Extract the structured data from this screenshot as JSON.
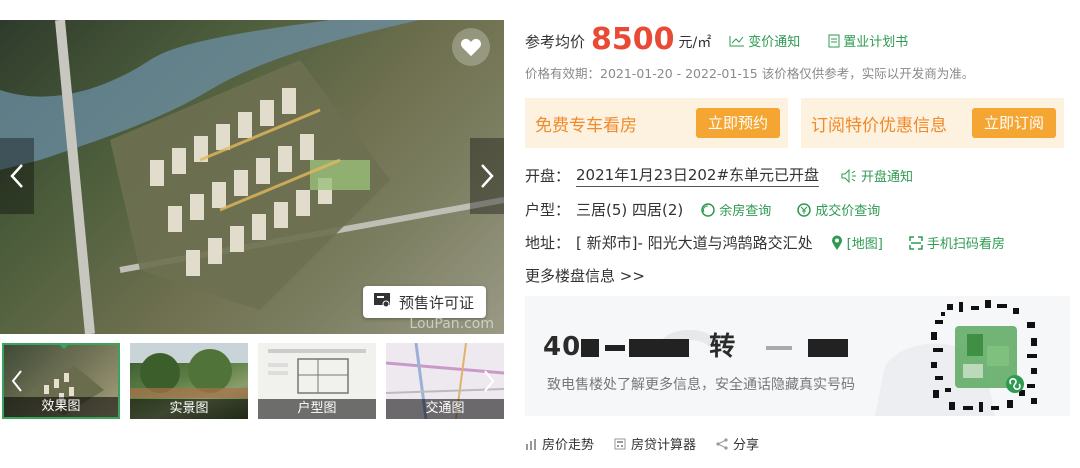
{
  "gallery": {
    "watermark": "LouPan.com",
    "permit_label": "预售许可证",
    "thumbs": [
      {
        "label": "效果图"
      },
      {
        "label": "实景图"
      },
      {
        "label": "户型图"
      },
      {
        "label": "交通图"
      }
    ]
  },
  "price": {
    "label": "参考均价",
    "value": "8500",
    "unit": "元/㎡",
    "change_notice": "变价通知",
    "purchase_plan": "置业计划书",
    "validity": "价格有效期：2021-01-20 - 2022-01-15 该价格仅供参考，实际以开发商为准。"
  },
  "promos": [
    {
      "text": "免费专车看房",
      "button": "立即预约"
    },
    {
      "text": "订阅特价优惠信息",
      "button": "立即订阅"
    }
  ],
  "details": {
    "open_label": "开盘：",
    "open_value": "2021年1月23日202#东单元已开盘",
    "open_notice": "开盘通知",
    "type_label": "户型：",
    "type_value": "三居(5) 四居(2)",
    "remaining_query": "余房查询",
    "deal_price_query": "成交价查询",
    "address_label": "地址：",
    "address_value": "[ 新郑市]- 阳光大道与鸿鹄路交汇处",
    "map_link": "[地图]",
    "scan_link": "手机扫码看房",
    "more_info": "更多楼盘信息 >>"
  },
  "phone": {
    "prefix": "40",
    "transfer": "转",
    "tip": "致电售楼处了解更多信息，安全通话隐藏真实号码"
  },
  "bottom": {
    "trend": "房价走势",
    "calculator": "房贷计算器",
    "share": "分享"
  },
  "colors": {
    "price": "#e94a35",
    "green": "#2e9a52",
    "promo_bg": "#fdf1df",
    "promo_text": "#f08a2a",
    "promo_button": "#f5a632"
  }
}
